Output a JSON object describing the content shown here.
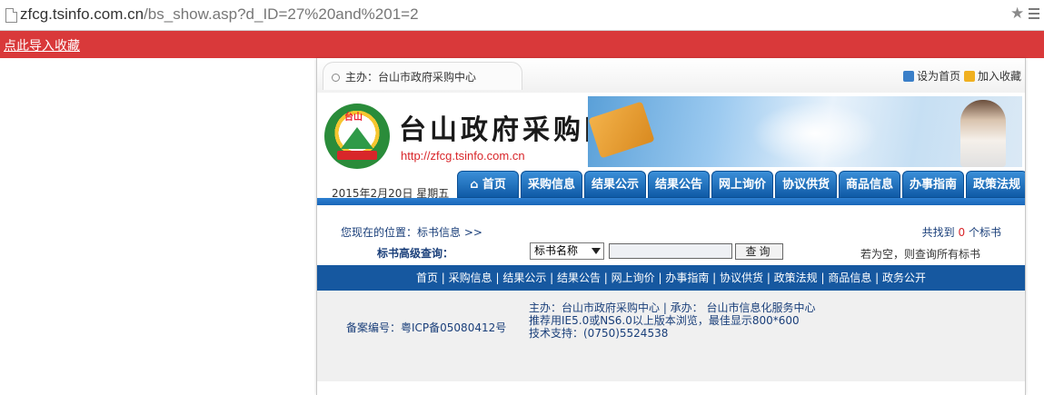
{
  "browser": {
    "url_host": "zfcg.tsinfo.com.cn",
    "url_path": "/bs_show.asp?d_ID=27%20and%201=2"
  },
  "bookmark_bar": {
    "link": "点此导入收藏"
  },
  "site": {
    "sponsor": "主办：台山市政府采购中心",
    "set_home": "设为首页",
    "add_fav": "加入收藏",
    "title": "台山政府采购网",
    "url": "http://zfcg.tsinfo.com.cn",
    "date": "2015年2月20日 星期五",
    "logo_text": "台山",
    "nav": [
      "首页",
      "采购信息",
      "结果公示",
      "结果公告",
      "网上询价",
      "协议供货",
      "商品信息",
      "办事指南",
      "政策法规"
    ],
    "location": "您现在的位置：标书信息 >>",
    "count_prefix": "共找到",
    "count_num": "0",
    "count_suffix": "个标书",
    "adv_label": "标书高级查询：",
    "adv_select": "标书名称",
    "adv_button": "查询",
    "hint": "若为空，则查询所有标书",
    "bottom_nav": "首页 | 采购信息 | 结果公示 | 结果公告 | 网上询价 | 办事指南 | 协议供货 | 政策法规 | 商品信息 | 政务公开",
    "icp": "备案编号：粤ICP备05080412号",
    "footer_line1": "主办：台山市政府采购中心 | 承办： 台山市信息化服务中心",
    "footer_line2": "推荐用IE5.0或NS6.0以上版本浏览，最佳显示800*600",
    "footer_line3": "技术支持：(0750)5524538"
  },
  "colors": {
    "redbar": "#d9393a",
    "nav_blue": "#1658a0",
    "count_red": "#d8262a"
  }
}
